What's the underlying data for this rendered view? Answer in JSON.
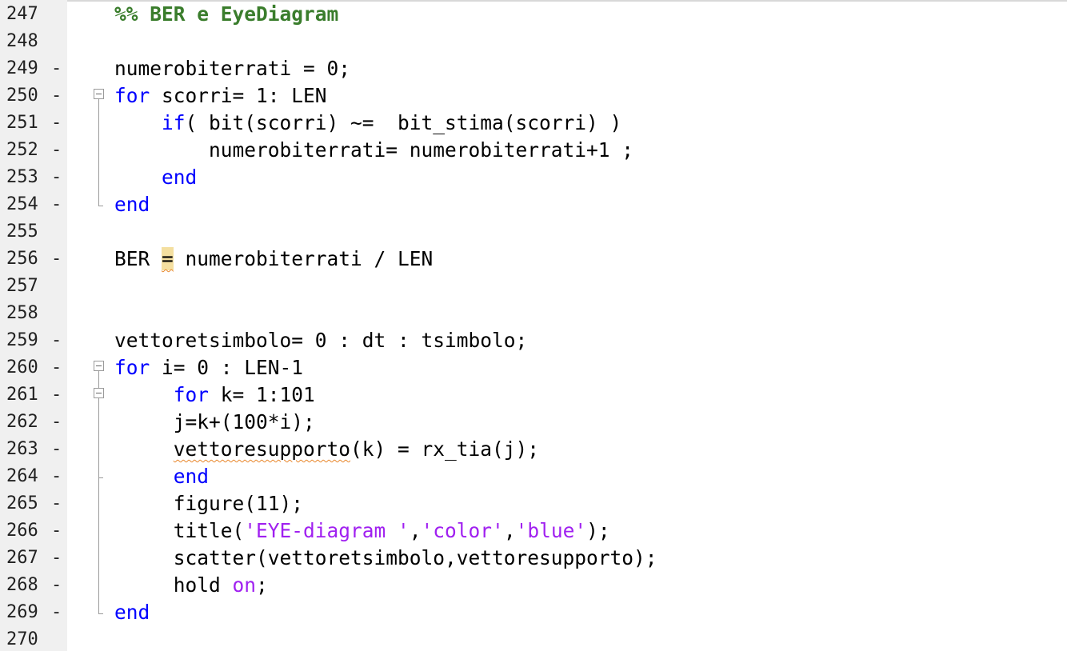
{
  "editor": {
    "lines": [
      {
        "num": "247",
        "dash": "",
        "tokens": [
          {
            "t": "%% BER e EyeDiagram",
            "c": "cm"
          }
        ]
      },
      {
        "num": "248",
        "dash": "",
        "tokens": []
      },
      {
        "num": "249",
        "dash": "-",
        "tokens": [
          {
            "t": "numerobiterrati = 0;"
          }
        ]
      },
      {
        "num": "250",
        "dash": "-",
        "tokens": [
          {
            "t": "for",
            "c": "kw"
          },
          {
            "t": " scorri= 1: LEN"
          }
        ]
      },
      {
        "num": "251",
        "dash": "-",
        "tokens": [
          {
            "t": "    "
          },
          {
            "t": "if",
            "c": "kw"
          },
          {
            "t": "( bit(scorri) ~=  bit_stima(scorri) )"
          }
        ]
      },
      {
        "num": "252",
        "dash": "-",
        "tokens": [
          {
            "t": "        numerobiterrati= numerobiterrati+1 ;"
          }
        ]
      },
      {
        "num": "253",
        "dash": "-",
        "tokens": [
          {
            "t": "    "
          },
          {
            "t": "end",
            "c": "kw"
          }
        ]
      },
      {
        "num": "254",
        "dash": "-",
        "tokens": [
          {
            "t": "end",
            "c": "kw"
          }
        ]
      },
      {
        "num": "255",
        "dash": "",
        "tokens": []
      },
      {
        "num": "256",
        "dash": "-",
        "tokens": [
          {
            "t": "BER "
          },
          {
            "t": "=",
            "c": "hl squig"
          },
          {
            "t": " numerobiterrati / LEN"
          }
        ]
      },
      {
        "num": "257",
        "dash": "",
        "tokens": []
      },
      {
        "num": "258",
        "dash": "",
        "tokens": []
      },
      {
        "num": "259",
        "dash": "-",
        "tokens": [
          {
            "t": "vettoretsimbolo= 0 : dt : tsimbolo;"
          }
        ]
      },
      {
        "num": "260",
        "dash": "-",
        "tokens": [
          {
            "t": "for",
            "c": "kw"
          },
          {
            "t": " i= 0 : LEN-1"
          }
        ]
      },
      {
        "num": "261",
        "dash": "-",
        "tokens": [
          {
            "t": "     "
          },
          {
            "t": "for",
            "c": "kw"
          },
          {
            "t": " k= 1:101"
          }
        ]
      },
      {
        "num": "262",
        "dash": "-",
        "tokens": [
          {
            "t": "     j=k+(100*i);"
          }
        ]
      },
      {
        "num": "263",
        "dash": "-",
        "tokens": [
          {
            "t": "     "
          },
          {
            "t": "vettoresupporto",
            "c": "squig"
          },
          {
            "t": "(k) = rx_tia(j);"
          }
        ]
      },
      {
        "num": "264",
        "dash": "-",
        "tokens": [
          {
            "t": "     "
          },
          {
            "t": "end",
            "c": "kw"
          }
        ]
      },
      {
        "num": "265",
        "dash": "-",
        "tokens": [
          {
            "t": "     figure(11);"
          }
        ]
      },
      {
        "num": "266",
        "dash": "-",
        "tokens": [
          {
            "t": "     title("
          },
          {
            "t": "'EYE-diagram '",
            "c": "str"
          },
          {
            "t": ","
          },
          {
            "t": "'color'",
            "c": "str"
          },
          {
            "t": ","
          },
          {
            "t": "'blue'",
            "c": "str"
          },
          {
            "t": ");"
          }
        ]
      },
      {
        "num": "267",
        "dash": "-",
        "tokens": [
          {
            "t": "     scatter(vettoretsimbolo,vettoresupporto);"
          }
        ]
      },
      {
        "num": "268",
        "dash": "-",
        "tokens": [
          {
            "t": "     hold "
          },
          {
            "t": "on",
            "c": "str"
          },
          {
            "t": ";"
          }
        ]
      },
      {
        "num": "269",
        "dash": "-",
        "tokens": [
          {
            "t": "end",
            "c": "kw"
          }
        ]
      },
      {
        "num": "270",
        "dash": "",
        "tokens": []
      }
    ]
  },
  "colors": {
    "keyword": "#0000ff",
    "comment": "#3a7d2c",
    "string": "#a020f0",
    "gutter": "#f0f0f0",
    "highlight": "#f4dfa0",
    "warning_squiggle": "#e8862a"
  }
}
